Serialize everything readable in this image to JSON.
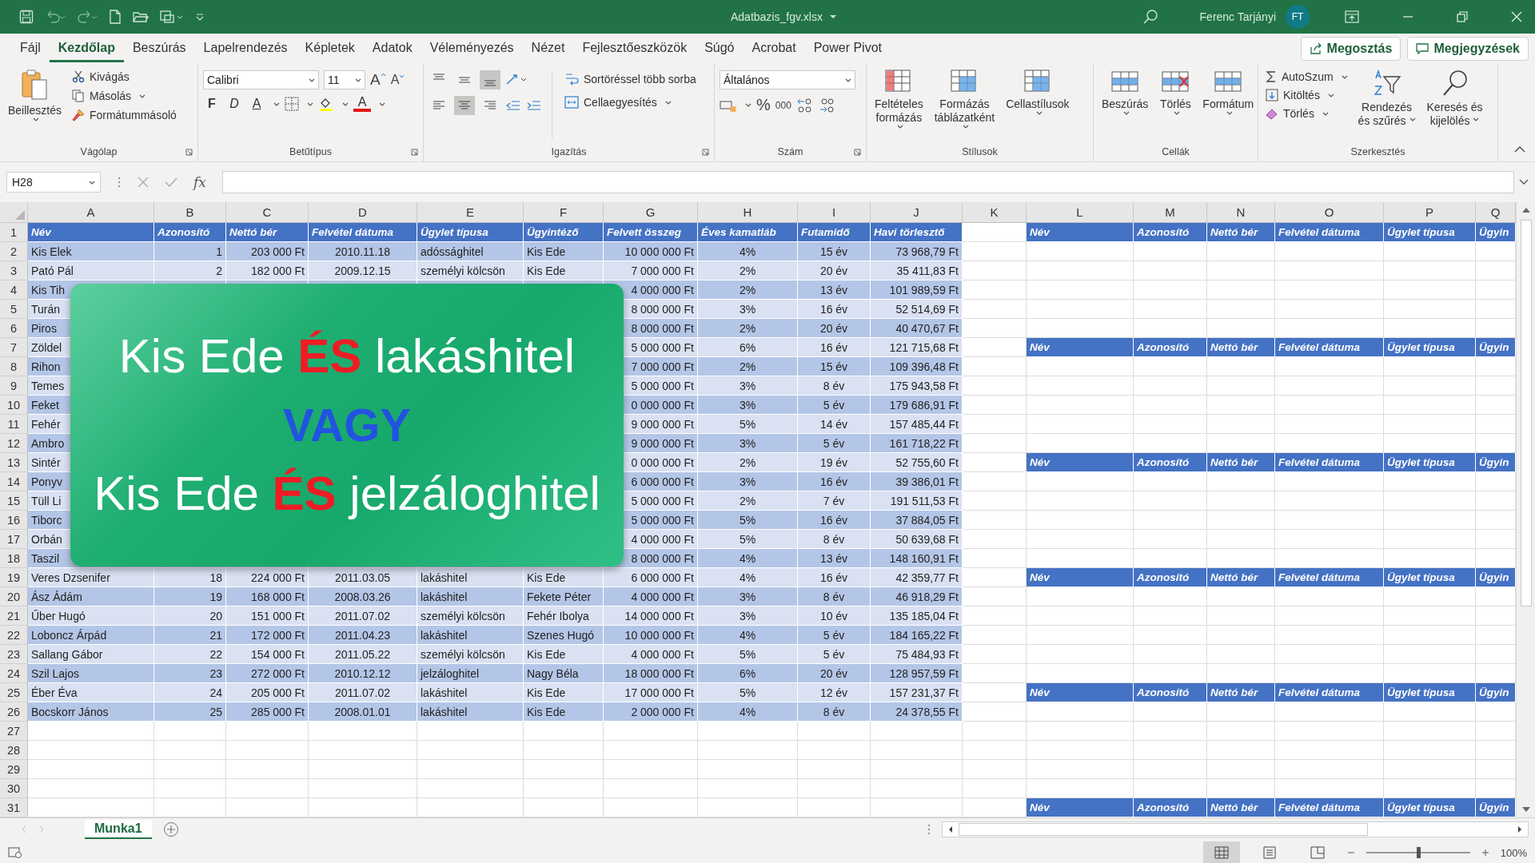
{
  "title_bar": {
    "file_name": "Adatbazis_fgv.xlsx",
    "user_name": "Ferenc Tarjányi",
    "user_initials": "FT"
  },
  "menu_tabs": [
    {
      "label": "Fájl",
      "selected": false
    },
    {
      "label": "Kezdőlap",
      "selected": true
    },
    {
      "label": "Beszúrás",
      "selected": false
    },
    {
      "label": "Lapelrendezés",
      "selected": false
    },
    {
      "label": "Képletek",
      "selected": false
    },
    {
      "label": "Adatok",
      "selected": false
    },
    {
      "label": "Véleményezés",
      "selected": false
    },
    {
      "label": "Nézet",
      "selected": false
    },
    {
      "label": "Fejlesztőeszközök",
      "selected": false
    },
    {
      "label": "Súgó",
      "selected": false
    },
    {
      "label": "Acrobat",
      "selected": false
    },
    {
      "label": "Power Pivot",
      "selected": false
    }
  ],
  "share_button": "Megosztás",
  "comments_button": "Megjegyzések",
  "ribbon": {
    "clipboard": {
      "paste": "Beillesztés",
      "cut": "Kivágás",
      "copy": "Másolás",
      "format_painter": "Formátummásoló",
      "label": "Vágólap"
    },
    "font": {
      "name": "Calibri",
      "size": "11",
      "grow": "A",
      "shrink": "A",
      "bold": "F",
      "italic": "D",
      "underline": "A",
      "font_color": "A",
      "label": "Betűtípus"
    },
    "alignment": {
      "vertical": [
        {
          "selected": false
        },
        {
          "selected": false
        },
        {
          "selected": true
        }
      ],
      "horizontal": [
        {
          "selected": false
        },
        {
          "selected": true
        },
        {
          "selected": false
        }
      ],
      "wrap": "Sortöréssel több sorba",
      "merge": "Cellaegyesítés",
      "label": "Igazítás"
    },
    "number": {
      "format": "Általános",
      "percent": "%",
      "thousands": "000",
      "label": "Szám"
    },
    "styles": {
      "buttons": [
        {
          "lines": [
            "Feltételes",
            "formázás"
          ]
        },
        {
          "lines": [
            "Formázás",
            "táblázatként"
          ]
        },
        {
          "lines": [
            "Cellastílusok"
          ]
        }
      ],
      "label": "Stílusok"
    },
    "cells": {
      "buttons": [
        "Beszúrás",
        "Törlés",
        "Formátum"
      ],
      "label": "Cellák"
    },
    "editing": {
      "autosum": "AutoSzum",
      "fill": "Kitöltés",
      "clear": "Törlés",
      "sort": [
        "Rendezés",
        "és szűrés"
      ],
      "find": [
        "Keresés és",
        "kijelölés"
      ],
      "label": "Szerkesztés"
    }
  },
  "formula_bar": {
    "name_box": "H28",
    "function_label": "fx"
  },
  "column_letters": [
    "A",
    "B",
    "C",
    "D",
    "E",
    "F",
    "G",
    "H",
    "I",
    "J",
    "K",
    "L",
    "M",
    "N",
    "O",
    "P",
    "Q"
  ],
  "row_numbers": [
    "1",
    "2",
    "3",
    "4",
    "5",
    "6",
    "7",
    "8",
    "9",
    "10",
    "11",
    "12",
    "13",
    "14",
    "15",
    "16",
    "17",
    "18",
    "19",
    "20",
    "21",
    "22",
    "23",
    "24",
    "25",
    "26",
    "27",
    "28",
    "29",
    "30",
    "31"
  ],
  "table": {
    "columns": [
      "Név",
      "Azonosító",
      "Nettó bér",
      "Felvétel dátuma",
      "Ügylet típusa",
      "Ügyintéző",
      "Felvett összeg",
      "Éves kamatláb",
      "Futamidő",
      "Havi törlesztő"
    ],
    "rows": [
      {
        "A": "Kis Elek",
        "B": "1",
        "C": "203 000 Ft",
        "D": "2010.11.18",
        "E": "adóssághitel",
        "F": "Kis Ede",
        "G": "10 000 000 Ft",
        "H": "4%",
        "I": "15 év",
        "J": "73 968,79 Ft"
      },
      {
        "A": "Pató Pál",
        "B": "2",
        "C": "182 000 Ft",
        "D": "2009.12.15",
        "E": "személyi kölcsön",
        "F": "Kis Ede",
        "G": "7 000 000 Ft",
        "H": "2%",
        "I": "20 év",
        "J": "35 411,83 Ft"
      },
      {
        "A": "Kis Tih",
        "G": "4 000 000 Ft",
        "H": "2%",
        "I": "13 év",
        "J": "101 989,59 Ft"
      },
      {
        "A": "Turán",
        "G": "8 000 000 Ft",
        "H": "3%",
        "I": "16 év",
        "J": "52 514,69 Ft"
      },
      {
        "A": "Piros",
        "G": "8 000 000 Ft",
        "H": "2%",
        "I": "20 év",
        "J": "40 470,67 Ft"
      },
      {
        "A": "Zöldel",
        "G": "5 000 000 Ft",
        "H": "6%",
        "I": "16 év",
        "J": "121 715,68 Ft"
      },
      {
        "A": "Rihon",
        "G": "7 000 000 Ft",
        "H": "2%",
        "I": "15 év",
        "J": "109 396,48 Ft"
      },
      {
        "A": "Temes",
        "G": "5 000 000 Ft",
        "H": "3%",
        "I": "8 év",
        "J": "175 943,58 Ft"
      },
      {
        "A": "Feket",
        "G": "0 000 000 Ft",
        "H": "3%",
        "I": "5 év",
        "J": "179 686,91 Ft"
      },
      {
        "A": "Fehér",
        "G": "9 000 000 Ft",
        "H": "5%",
        "I": "14 év",
        "J": "157 485,44 Ft"
      },
      {
        "A": "Ambro",
        "G": "9 000 000 Ft",
        "H": "3%",
        "I": "5 év",
        "J": "161 718,22 Ft"
      },
      {
        "A": "Sintér",
        "G": "0 000 000 Ft",
        "H": "2%",
        "I": "19 év",
        "J": "52 755,60 Ft"
      },
      {
        "A": "Ponyv",
        "G": "6 000 000 Ft",
        "H": "3%",
        "I": "16 év",
        "J": "39 386,01 Ft"
      },
      {
        "A": "Tüll Li",
        "G": "5 000 000 Ft",
        "H": "2%",
        "I": "7 év",
        "J": "191 511,53 Ft"
      },
      {
        "A": "Tiborc",
        "G": "5 000 000 Ft",
        "H": "5%",
        "I": "16 év",
        "J": "37 884,05 Ft"
      },
      {
        "A": "Orbán",
        "G": "4 000 000 Ft",
        "H": "5%",
        "I": "8 év",
        "J": "50 639,68 Ft"
      },
      {
        "A": "Taszil",
        "G": "8 000 000 Ft",
        "H": "4%",
        "I": "13 év",
        "J": "148 160,91 Ft"
      },
      {
        "A": "Veres Dzsenifer",
        "B": "18",
        "C": "224 000 Ft",
        "D": "2011.03.05",
        "E": "lakáshitel",
        "F": "Kis Ede",
        "G": "6 000 000 Ft",
        "H": "4%",
        "I": "16 év",
        "J": "42 359,77 Ft"
      },
      {
        "A": "Ász Ádám",
        "B": "19",
        "C": "168 000 Ft",
        "D": "2008.03.26",
        "E": "lakáshitel",
        "F": "Fekete Péter",
        "G": "4 000 000 Ft",
        "H": "3%",
        "I": "8 év",
        "J": "46 918,29 Ft"
      },
      {
        "A": "Űber Hugó",
        "B": "20",
        "C": "151 000 Ft",
        "D": "2011.07.02",
        "E": "személyi kölcsön",
        "F": "Fehér Ibolya",
        "G": "14 000 000 Ft",
        "H": "3%",
        "I": "10 év",
        "J": "135 185,04 Ft"
      },
      {
        "A": "Loboncz Árpád",
        "B": "21",
        "C": "172 000 Ft",
        "D": "2011.04.23",
        "E": "lakáshitel",
        "F": "Szenes Hugó",
        "G": "10 000 000 Ft",
        "H": "4%",
        "I": "5 év",
        "J": "184 165,22 Ft"
      },
      {
        "A": "Sallang Gábor",
        "B": "22",
        "C": "154 000 Ft",
        "D": "2011.05.22",
        "E": "személyi kölcsön",
        "F": "Kis Ede",
        "G": "4 000 000 Ft",
        "H": "5%",
        "I": "5 év",
        "J": "75 484,93 Ft"
      },
      {
        "A": "Szil Lajos",
        "B": "23",
        "C": "272 000 Ft",
        "D": "2010.12.12",
        "E": "jelzáloghitel",
        "F": "Nagy Béla",
        "G": "18 000 000 Ft",
        "H": "6%",
        "I": "20 év",
        "J": "128 957,59 Ft"
      },
      {
        "A": "Éber Éva",
        "B": "24",
        "C": "205 000 Ft",
        "D": "2011.07.02",
        "E": "lakáshitel",
        "F": "Kis Ede",
        "G": "17 000 000 Ft",
        "H": "5%",
        "I": "12 év",
        "J": "157 231,37 Ft"
      },
      {
        "A": "Bocskorr János",
        "B": "25",
        "C": "285 000 Ft",
        "D": "2008.01.01",
        "E": "lakáshitel",
        "F": "Kis Ede",
        "G": "2 000 000 Ft",
        "H": "4%",
        "I": "8 év",
        "J": "24 378,55 Ft"
      }
    ]
  },
  "criteria_blocks": [
    {
      "headers": [
        "Név",
        "Azonosító",
        "Nettó bér",
        "Felvétel dátuma",
        "Ügylet típusa",
        "Ügyin"
      ]
    },
    {
      "headers": [
        "Név",
        "Azonosító",
        "Nettó bér",
        "Felvétel dátuma",
        "Ügylet típusa",
        "Ügyin"
      ]
    },
    {
      "headers": [
        "Név",
        "Azonosító",
        "Nettó bér",
        "Felvétel dátuma",
        "Ügylet típusa",
        "Ügyin"
      ]
    },
    {
      "headers": [
        "Név",
        "Azonosító",
        "Nettó bér",
        "Felvétel dátuma",
        "Ügylet típusa",
        "Ügyin"
      ]
    },
    {
      "headers": [
        "Név",
        "Azonosító",
        "Nettó bér",
        "Felvétel dátuma",
        "Ügylet típusa",
        "Ügyin"
      ]
    },
    {
      "headers": [
        "Név",
        "Azonosító",
        "Nettó bér",
        "Felvétel dátuma",
        "Ügylet típusa",
        "Ügyin"
      ]
    }
  ],
  "caption_card": {
    "lines": [
      {
        "text": "Kis Ede **ÉS** lakáshitel",
        "kind": "plain"
      },
      {
        "text": "VAGY",
        "kind": "emphasis"
      },
      {
        "text": "Kis Ede **ÉS** jelzáloghitel",
        "kind": "plain"
      }
    ]
  },
  "sheet_tabs": [
    {
      "label": "Munka1",
      "selected": true
    }
  ],
  "status_bar": {
    "views": [
      {
        "selected": true
      },
      {
        "selected": false
      },
      {
        "selected": false
      }
    ],
    "zoom": {
      "level": 0.5,
      "label": "100%"
    }
  }
}
